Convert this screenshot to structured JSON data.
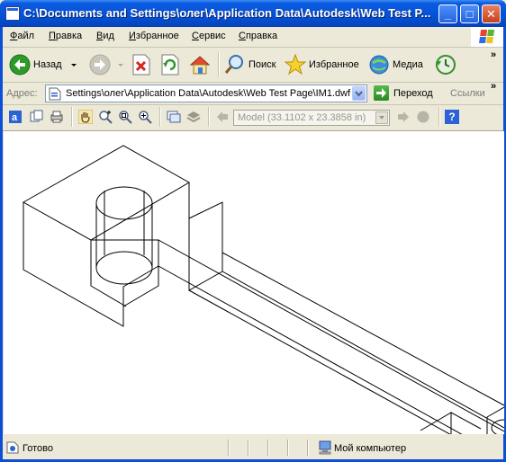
{
  "window": {
    "title": "C:\\Documents and Settings\\олег\\Application Data\\Autodesk\\Web Test P...",
    "minimize_label": "_",
    "maximize_label": "□",
    "close_label": "✕"
  },
  "menu": {
    "items": [
      {
        "accel": "Ф",
        "rest": "айл"
      },
      {
        "accel": "П",
        "rest": "равка"
      },
      {
        "accel": "В",
        "rest": "ид"
      },
      {
        "accel": "И",
        "rest": "збранное"
      },
      {
        "accel": "С",
        "rest": "ервис"
      },
      {
        "accel": "С",
        "rest": "правка"
      }
    ]
  },
  "toolbar": {
    "back_label": "Назад",
    "search_label": "Поиск",
    "favorites_label": "Избранное",
    "media_label": "Медиа",
    "chevron": "»"
  },
  "address": {
    "label": "Адрес:",
    "value": "Settings\\олег\\Application Data\\Autodesk\\Web Test Page\\IM1.dwf",
    "go_label": "Переход",
    "links_label": "Ссылки",
    "chevron": "»"
  },
  "viewer": {
    "model_value": "Model (33.1102 x 23.3858 in)",
    "help_label": "?"
  },
  "status": {
    "text": "Готово",
    "zone": "Мой компьютер"
  },
  "colors": {
    "titlebar": "#0553d9",
    "chrome": "#ece9d8",
    "canvas": "#ffffff",
    "drawing": "#000000"
  }
}
